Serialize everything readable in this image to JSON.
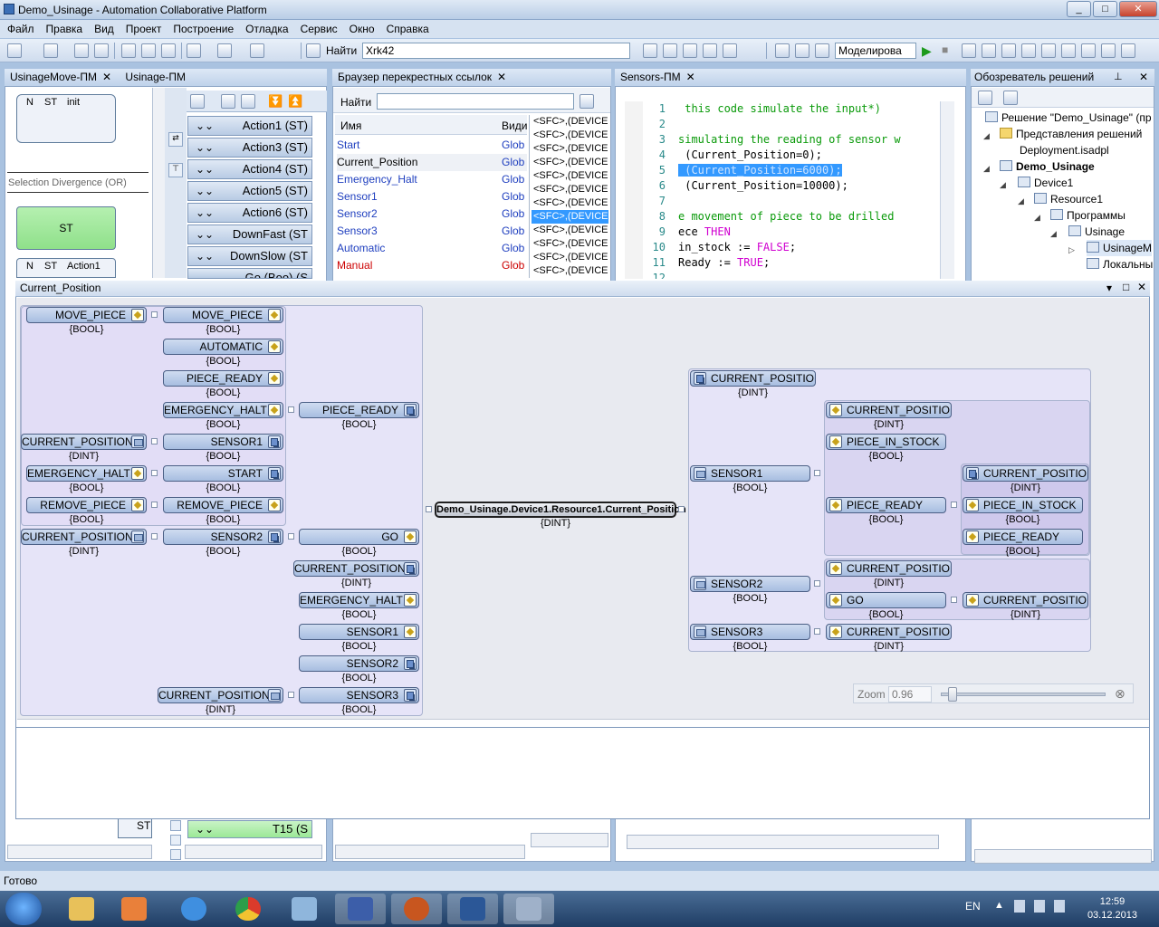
{
  "app": {
    "title": "Demo_Usinage - Automation Collaborative Platform"
  },
  "menu": [
    "Файл",
    "Правка",
    "Вид",
    "Проект",
    "Построение",
    "Отладка",
    "Сервис",
    "Окно",
    "Справка"
  ],
  "toolbar": {
    "find_label": "Найти",
    "find_value": "Xrk42",
    "sim_value": "Моделирова"
  },
  "sfc_panel": {
    "tabs": [
      "UsinageMove-ПМ",
      "Usinage-ПМ"
    ],
    "box1_n": "N",
    "box1_st": "ST",
    "box1_name": "init",
    "divergence": "Selection Divergence (OR)",
    "st_label": "ST",
    "box2_n": "N",
    "box2_st": "ST",
    "box2_name": "Action1",
    "st_bottom": "ST",
    "actions": [
      "Action1 (ST)",
      "Action3 (ST)",
      "Action4 (ST)",
      "Action5 (ST)",
      "Action6 (ST)",
      "DownFast (ST",
      "DownSlow (ST",
      "Go (Boo) (S"
    ],
    "t15": "T15 (S"
  },
  "xref": {
    "title": "Браузер перекрестных ссылок",
    "find_label": "Найти",
    "col_name": "Имя",
    "col_kind": "Види",
    "rows": [
      {
        "name": "Start",
        "kind": "Glob"
      },
      {
        "name": "Current_Position",
        "kind": "Glob"
      },
      {
        "name": "Emergency_Halt",
        "kind": "Glob"
      },
      {
        "name": "Sensor1",
        "kind": "Glob"
      },
      {
        "name": "Sensor2",
        "kind": "Glob"
      },
      {
        "name": "Sensor3",
        "kind": "Glob"
      },
      {
        "name": "Automatic",
        "kind": "Glob"
      },
      {
        "name": "Manual",
        "kind": "Glob"
      }
    ],
    "refs": [
      "<SFC>,(DEVICE",
      "<SFC>,(DEVICE",
      "<SFC>,(DEVICE",
      "<SFC>,(DEVICE",
      "<SFC>,(DEVICE",
      "<SFC>,(DEVICE",
      "<SFC>,(DEVICE",
      "<SFC>,(DEVICE",
      "<SFC>,(DEVICE",
      "<SFC>,(DEVICE",
      "<SFC>,(DEVICE",
      "<SFC>,(DEVICE"
    ]
  },
  "editor": {
    "tab": "Sensors-ПМ",
    "lines": [
      {
        "n": "1",
        "a": "",
        "b": " this code simulate the input*)",
        "c": "",
        "d": ""
      },
      {
        "n": "2",
        "a": "",
        "b": "",
        "c": "",
        "d": ""
      },
      {
        "n": "3",
        "a": "",
        "b": "simulating the reading of sensor w",
        "c": "",
        "d": ""
      },
      {
        "n": "4",
        "a": " (Current_Position=0);",
        "b": "",
        "c": "",
        "d": ""
      },
      {
        "n": "5",
        "a": " (Current_Position=6000);",
        "b": "",
        "c": "",
        "d": ""
      },
      {
        "n": "6",
        "a": " (Current_Position=10000);",
        "b": "",
        "c": "",
        "d": ""
      },
      {
        "n": "7",
        "a": "",
        "b": "",
        "c": "",
        "d": ""
      },
      {
        "n": "8",
        "a": "",
        "b": "e movement of piece to be drilled",
        "c": "",
        "d": ""
      },
      {
        "n": "9",
        "a": "ece ",
        "b": "",
        "c": "THEN",
        "d": ""
      },
      {
        "n": "10",
        "a": "in_stock := ",
        "b": "",
        "c": "FALSE",
        "d": ";"
      },
      {
        "n": "11",
        "a": "Ready := ",
        "b": "",
        "c": "TRUE",
        "d": ";"
      },
      {
        "n": "12",
        "a": "",
        "b": "",
        "c": "",
        "d": ""
      }
    ]
  },
  "solution": {
    "title": "Обозреватель решений",
    "nodes": [
      "Решение \"Demo_Usinage\" (пр",
      "Представления решений",
      "Deployment.isadpl",
      "Demo_Usinage",
      "Device1",
      "Resource1",
      "Программы",
      "Usinage",
      "UsinageM",
      "Локальны"
    ]
  },
  "dialog": {
    "title": "Current_Position",
    "center": "Demo_Usinage.Device1.Resource1.Current_Position",
    "center_type": "{DINT}",
    "zoom_label": "Zoom",
    "zoom_value": "0.96",
    "left_nodes": [
      {
        "label": "MOVE_PIECE",
        "type": "{BOOL}"
      },
      {
        "label": "MOVE_PIECE",
        "type": "{BOOL}"
      },
      {
        "label": "AUTOMATIC",
        "type": "{BOOL}"
      },
      {
        "label": "PIECE_READY",
        "type": "{BOOL}"
      },
      {
        "label": "EMERGENCY_HALT",
        "type": "{BOOL}"
      },
      {
        "label": "PIECE_READY",
        "type": "{BOOL}"
      },
      {
        "label": "CURRENT_POSITION",
        "type": "{DINT}"
      },
      {
        "label": "SENSOR1",
        "type": "{BOOL}"
      },
      {
        "label": "EMERGENCY_HALT",
        "type": "{BOOL}"
      },
      {
        "label": "START",
        "type": "{BOOL}"
      },
      {
        "label": "REMOVE_PIECE",
        "type": "{BOOL}"
      },
      {
        "label": "REMOVE_PIECE",
        "type": "{BOOL}"
      },
      {
        "label": "CURRENT_POSITION",
        "type": "{DINT}"
      },
      {
        "label": "SENSOR2",
        "type": "{BOOL}"
      },
      {
        "label": "GO",
        "type": "{BOOL}"
      },
      {
        "label": "CURRENT_POSITION",
        "type": "{DINT}"
      },
      {
        "label": "EMERGENCY_HALT",
        "type": "{BOOL}"
      },
      {
        "label": "SENSOR1",
        "type": "{BOOL}"
      },
      {
        "label": "SENSOR2",
        "type": "{BOOL}"
      },
      {
        "label": "CURRENT_POSITION",
        "type": "{DINT}"
      },
      {
        "label": "SENSOR3",
        "type": "{BOOL}"
      }
    ],
    "right_nodes": [
      {
        "label": "CURRENT_POSITION",
        "type": "{DINT}"
      },
      {
        "label": "CURRENT_POSITION",
        "type": "{DINT}"
      },
      {
        "label": "PIECE_IN_STOCK",
        "type": "{BOOL}"
      },
      {
        "label": "SENSOR1",
        "type": "{BOOL}"
      },
      {
        "label": "CURRENT_POSITION",
        "type": "{DINT}"
      },
      {
        "label": "PIECE_READY",
        "type": "{BOOL}"
      },
      {
        "label": "PIECE_IN_STOCK",
        "type": "{BOOL}"
      },
      {
        "label": "PIECE_READY",
        "type": "{BOOL}"
      },
      {
        "label": "CURRENT_POSITION",
        "type": "{DINT}"
      },
      {
        "label": "SENSOR2",
        "type": "{BOOL}"
      },
      {
        "label": "GO",
        "type": "{BOOL}"
      },
      {
        "label": "CURRENT_POSITION",
        "type": "{DINT}"
      },
      {
        "label": "SENSOR3",
        "type": "{BOOL}"
      },
      {
        "label": "CURRENT_POSITION",
        "type": "{DINT}"
      }
    ]
  },
  "status": "Готово",
  "taskbar": {
    "lang": "EN",
    "time": "12:59",
    "date": "03.12.2013"
  },
  "colors": {
    "accent": "#3399ff",
    "red_item": "#cc0000",
    "link_blue": "#1f3fbf",
    "sfc_green": "#9be896"
  }
}
